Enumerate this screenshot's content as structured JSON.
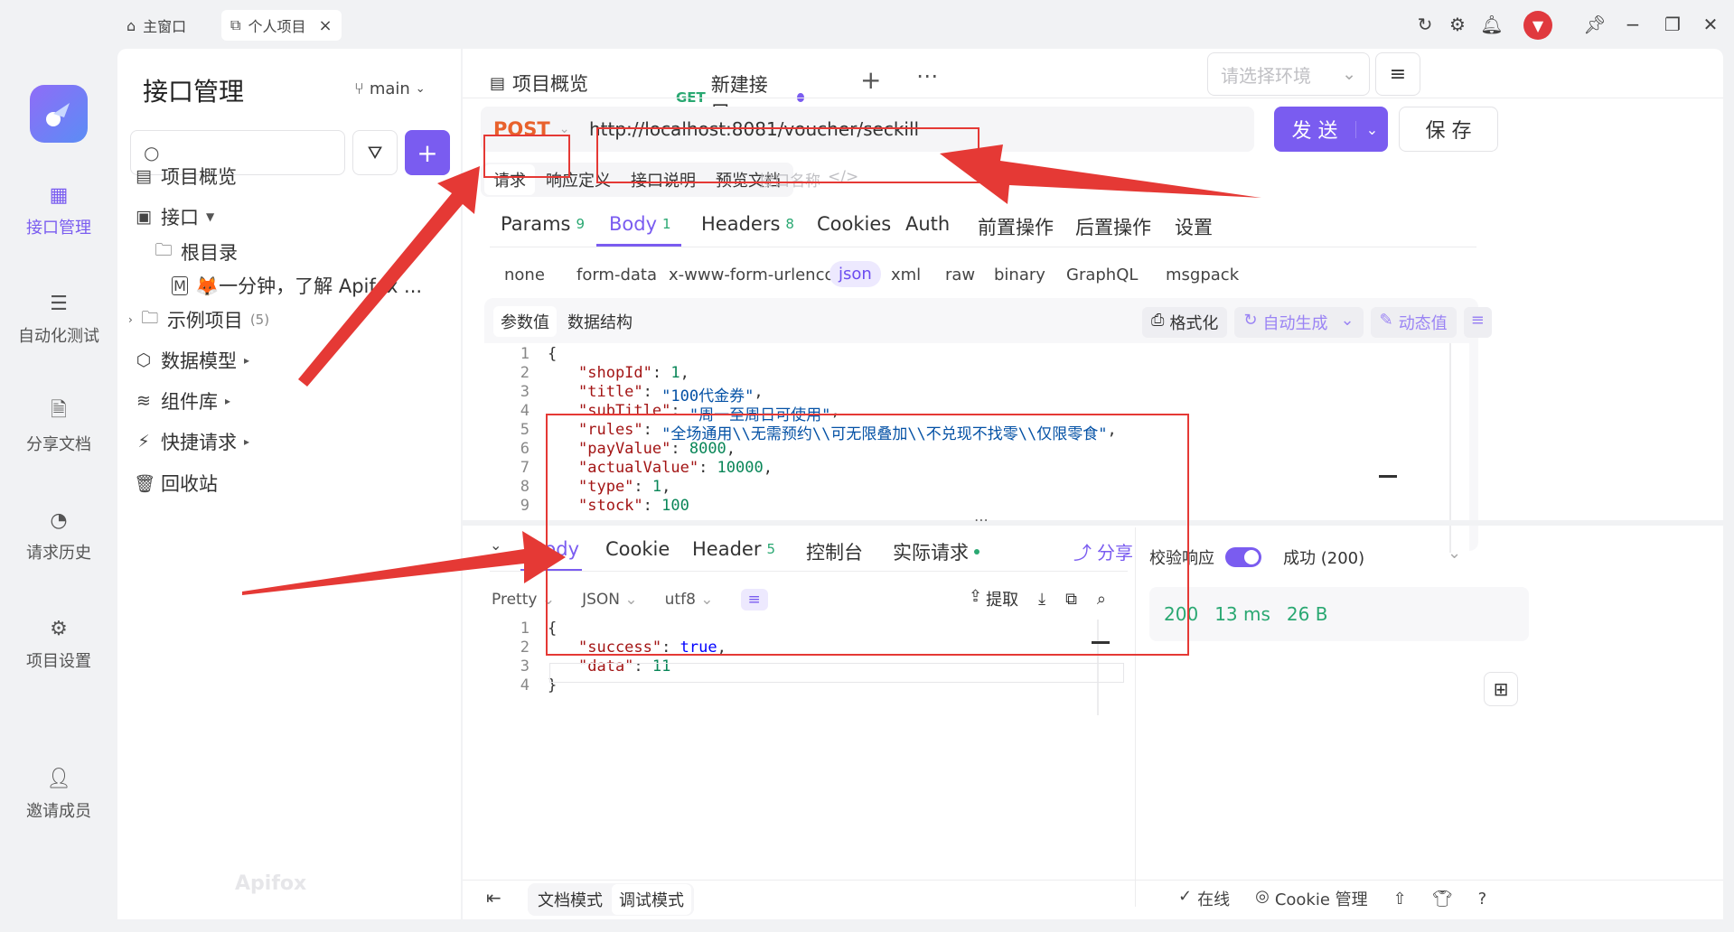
{
  "titlebar": {
    "tab_home": "主窗口",
    "tab_project": "个人项目",
    "tab_close": "×"
  },
  "rail": {
    "items": [
      {
        "label": "接口管理"
      },
      {
        "label": "自动化测试"
      },
      {
        "label": "分享文档"
      },
      {
        "label": "请求历史"
      },
      {
        "label": "项目设置"
      },
      {
        "label": "邀请成员"
      }
    ],
    "brand": "Apifox"
  },
  "tree": {
    "title": "接口管理",
    "branch": "main",
    "search_placeholder": "",
    "items": [
      {
        "label": "项目概览"
      },
      {
        "label": "接口"
      },
      {
        "label": "根目录"
      },
      {
        "label": "🦊一分钟，了解 Apifox ..."
      },
      {
        "label": "示例项目",
        "count": "(5)"
      },
      {
        "label": "数据模型"
      },
      {
        "label": "组件库"
      },
      {
        "label": "快捷请求"
      },
      {
        "label": "回收站"
      }
    ]
  },
  "tabs": {
    "overview": "项目概览",
    "new_method": "GET",
    "new_label": "新建接口",
    "env_placeholder": "请选择环境"
  },
  "request": {
    "method": "POST",
    "url": "http://localhost:8081/voucher/seckill",
    "send": "发 送",
    "save": "保 存",
    "doc_tabs": [
      "请求",
      "响应定义",
      "接口说明",
      "预览文档"
    ],
    "name_placeholder": "接口名称"
  },
  "param_tabs": [
    {
      "label": "Params",
      "count": "9"
    },
    {
      "label": "Body",
      "count": "1"
    },
    {
      "label": "Headers",
      "count": "8"
    },
    {
      "label": "Cookies",
      "count": ""
    },
    {
      "label": "Auth",
      "count": ""
    },
    {
      "label": "前置操作",
      "count": ""
    },
    {
      "label": "后置操作",
      "count": ""
    },
    {
      "label": "设置",
      "count": ""
    }
  ],
  "body_types": [
    "none",
    "form-data",
    "x-www-form-urlencoded",
    "json",
    "xml",
    "raw",
    "binary",
    "GraphQL",
    "msgpack"
  ],
  "body_toolbar": {
    "seg1": "参数值",
    "seg2": "数据结构",
    "format": "格式化",
    "auto_gen": "自动生成",
    "dynamic": "动态值"
  },
  "request_body": [
    {
      "n": "1",
      "t": "{"
    },
    {
      "n": "2",
      "key": "\"shopId\"",
      "val": "1",
      "vt": "n"
    },
    {
      "n": "3",
      "key": "\"title\"",
      "val": "\"100代金券\"",
      "vt": "s"
    },
    {
      "n": "4",
      "key": "\"subTitle\"",
      "val": "\"周一至周日可使用\"",
      "vt": "s"
    },
    {
      "n": "5",
      "key": "\"rules\"",
      "val": "\"全场通用\\\\无需预约\\\\可无限叠加\\\\不兑现不找零\\\\仅限零食\"",
      "vt": "s"
    },
    {
      "n": "6",
      "key": "\"payValue\"",
      "val": "8000",
      "vt": "n"
    },
    {
      "n": "7",
      "key": "\"actualValue\"",
      "val": "10000",
      "vt": "n"
    },
    {
      "n": "8",
      "key": "\"type\"",
      "val": "1",
      "vt": "n"
    },
    {
      "n": "9",
      "key": "\"stock\"",
      "val": "100",
      "vt": "n"
    }
  ],
  "response_tabs": [
    {
      "label": "Body"
    },
    {
      "label": "Cookie"
    },
    {
      "label": "Header",
      "count": "5"
    },
    {
      "label": "控制台"
    },
    {
      "label": "实际请求"
    }
  ],
  "response": {
    "share": "分享",
    "pretty": "Pretty",
    "format": "JSON",
    "encoding": "utf8",
    "extract": "提取",
    "body": [
      {
        "n": "1",
        "t": "{"
      },
      {
        "n": "2",
        "key": "\"success\"",
        "val": "true",
        "vt": "b"
      },
      {
        "n": "3",
        "key": "\"data\"",
        "val": "11",
        "vt": "n"
      },
      {
        "n": "4",
        "t": "}"
      }
    ],
    "validate_label": "校验响应",
    "status_select": "成功 (200)",
    "status_code": "200",
    "time": "13 ms",
    "size": "26 B"
  },
  "footer": {
    "doc_mode": "文档模式",
    "debug_mode": "调试模式",
    "online": "在线",
    "cookie": "Cookie 管理"
  },
  "colors": {
    "accent": "#7a5cf0",
    "method": "#e8612c",
    "success": "#2aa872",
    "annotation": "#e53935"
  }
}
